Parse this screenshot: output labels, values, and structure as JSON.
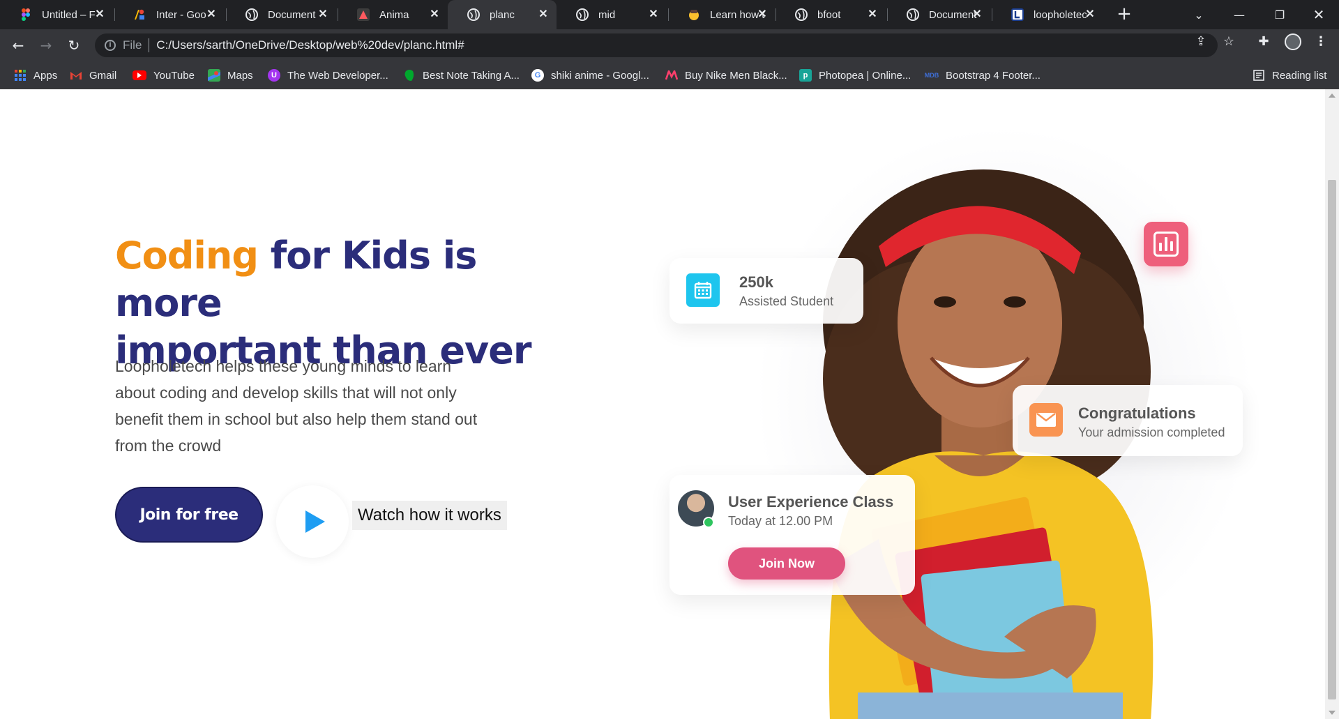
{
  "browser": {
    "tabs": [
      {
        "title": "Untitled – F",
        "icon": "figma-icon",
        "active": false
      },
      {
        "title": "Inter - Goo",
        "icon": "google-fonts-icon",
        "active": false
      },
      {
        "title": "Document",
        "icon": "globe-icon",
        "active": false
      },
      {
        "title": "Anima",
        "icon": "anima-icon",
        "active": false
      },
      {
        "title": "planc",
        "icon": "globe-icon",
        "active": true
      },
      {
        "title": "mid",
        "icon": "globe-icon",
        "active": false
      },
      {
        "title": "Learn how t",
        "icon": "emoji-icon",
        "active": false
      },
      {
        "title": "bfoot",
        "icon": "globe-icon",
        "active": false
      },
      {
        "title": "Document",
        "icon": "globe-icon",
        "active": false
      },
      {
        "title": "loopholetec",
        "icon": "loopholetech-icon",
        "active": false
      }
    ],
    "address": {
      "scheme": "File",
      "url": "C:/Users/sarth/OneDrive/Desktop/web%20dev/planc.html#"
    },
    "bookmarks": [
      {
        "label": "Apps",
        "icon": "apps-grid-icon"
      },
      {
        "label": "Gmail",
        "icon": "gmail-icon"
      },
      {
        "label": "YouTube",
        "icon": "youtube-icon"
      },
      {
        "label": "Maps",
        "icon": "maps-icon"
      },
      {
        "label": "The Web Developer...",
        "icon": "udemy-icon"
      },
      {
        "label": "Best Note Taking A...",
        "icon": "evernote-icon"
      },
      {
        "label": "shiki anime - Googl...",
        "icon": "google-icon"
      },
      {
        "label": "Buy Nike Men Black...",
        "icon": "myntra-icon"
      },
      {
        "label": "Photopea | Online...",
        "icon": "photopea-icon"
      },
      {
        "label": "Bootstrap 4 Footer...",
        "icon": "mdb-icon"
      }
    ],
    "reading_list": "Reading list"
  },
  "hero": {
    "headline_accent": "Coding",
    "headline_rest_1": " for Kids is more",
    "headline_rest_2": "important than ever",
    "lead": "Loopholetech helps these young minds to learn about coding and develop skills that will not only benefit them in school but also help them stand out from the crowd",
    "join_label": "Join for free",
    "watch_label": "Watch how it works"
  },
  "cards": {
    "stat": {
      "value": "250k",
      "label": "Assisted Student"
    },
    "congrats": {
      "title": "Congratulations",
      "subtitle": "Your admission completed"
    },
    "class": {
      "title": "User Experience Class",
      "time": "Today at 12.00 PM",
      "cta": "Join Now"
    }
  },
  "colors": {
    "accent": "#f18f14",
    "primary": "#2b2d7a",
    "play": "#1e9df2",
    "calendar_badge": "#1ec5ee",
    "mail_badge": "#f99452",
    "chart_badge": "#ee5f7b",
    "join_now": "#e0537e"
  }
}
